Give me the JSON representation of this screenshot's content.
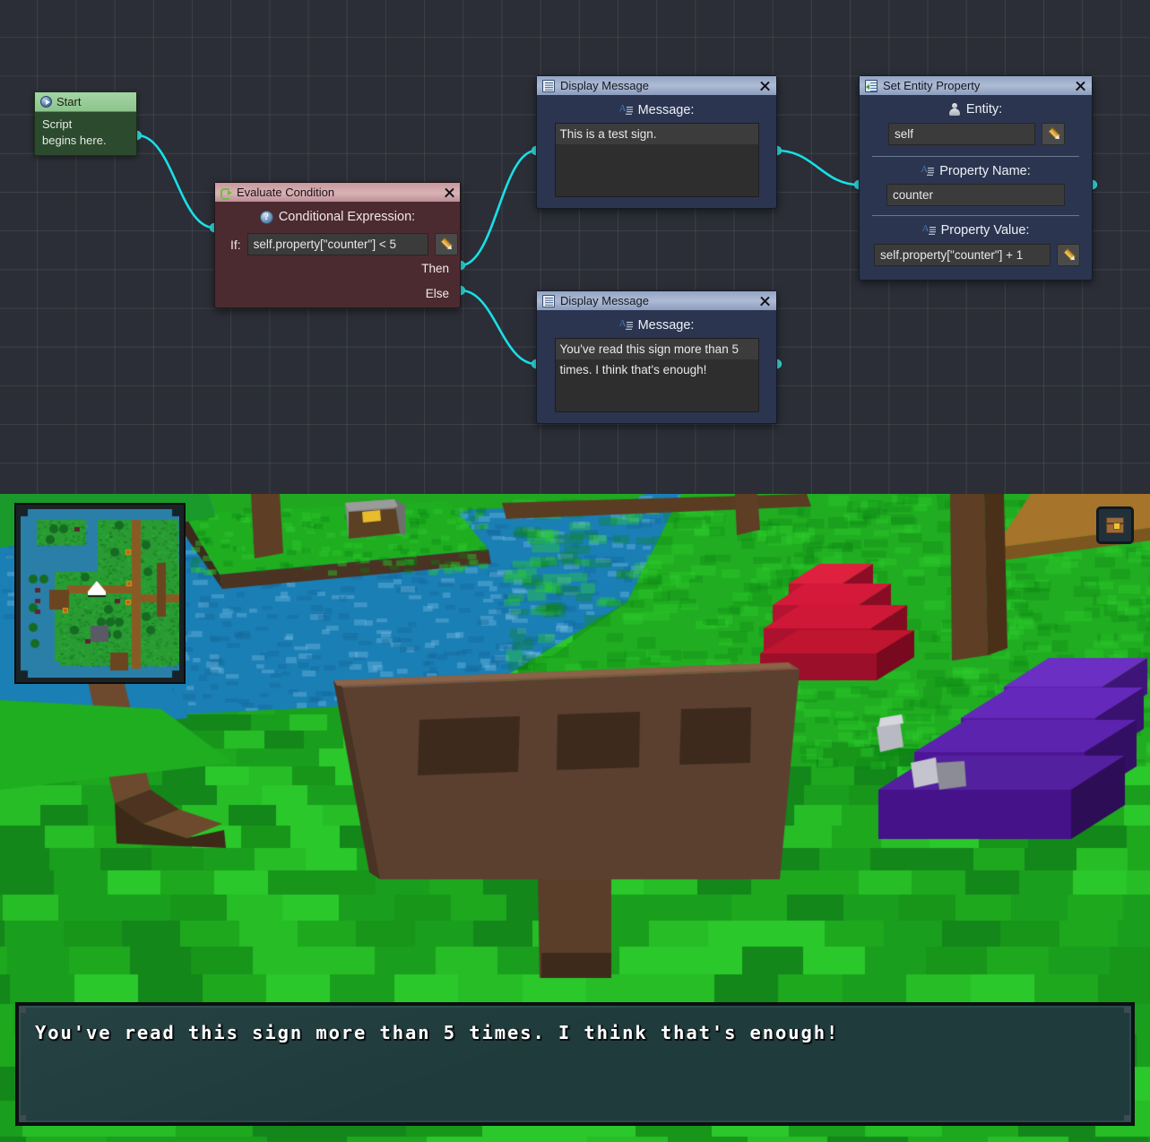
{
  "editor": {
    "nodes": {
      "start": {
        "title": "Start",
        "icon": "play-icon",
        "body_line1": "Script",
        "body_line2": "begins here."
      },
      "evaluate_condition": {
        "title": "Evaluate Condition",
        "icon": "branch-icon",
        "close_label": "✕",
        "field_label": "Conditional Expression:",
        "help_icon": "?",
        "if_label": "If:",
        "expression_value": "self.property[\"counter\"] < 5",
        "edit_icon": "pencil-icon",
        "then_label": "Then",
        "else_label": "Else"
      },
      "display_message_1": {
        "title": "Display Message",
        "icon": "document-icon",
        "close_label": "✕",
        "field_label": "Message:",
        "message_value": "This is a test sign."
      },
      "display_message_2": {
        "title": "Display Message",
        "icon": "document-icon",
        "close_label": "✕",
        "field_label": "Message:",
        "message_line1": "You've read this sign more than 5",
        "message_line2": "times. I think that's enough!"
      },
      "set_entity_property": {
        "title": "Set Entity Property",
        "icon": "set-property-icon",
        "close_label": "✕",
        "entity_label": "Entity:",
        "entity_value": "self",
        "entity_edit_icon": "pencil-icon",
        "property_name_label": "Property Name:",
        "property_name_value": "counter",
        "property_value_label": "Property Value:",
        "property_value_value": "self.property[\"counter\"] + 1",
        "property_value_edit_icon": "pencil-icon"
      }
    },
    "colors": {
      "canvas_bg": "#2b2e36",
      "grid_line": "#3a3d46",
      "wire": "#18e0e8",
      "start_body": "#2b4a2e",
      "start_title": "#9ccd9c",
      "condition_body": "#4c2b30",
      "condition_title": "#d0a4aa",
      "blue_body": "#2b3550",
      "blue_title": "#a2b2cc"
    }
  },
  "game": {
    "minimap": {
      "name": "minimap",
      "player_marker": "player-arrow-icon"
    },
    "inventory_button": {
      "name": "inventory-button",
      "icon": "chest-icon"
    },
    "dialogue": {
      "text": "You've read this sign more than 5 times. I think that's enough!"
    },
    "colors": {
      "grass": "#20a820",
      "grass_dark": "#158a17",
      "water": "#1a7fb5",
      "wood": "#6b4a32",
      "sign": "#5b4030",
      "creature_red": "#c0152e",
      "creature_purple": "#5a1fa8",
      "dialogue_bg": "#1f3b3c",
      "dialogue_border": "#0c1013"
    }
  }
}
